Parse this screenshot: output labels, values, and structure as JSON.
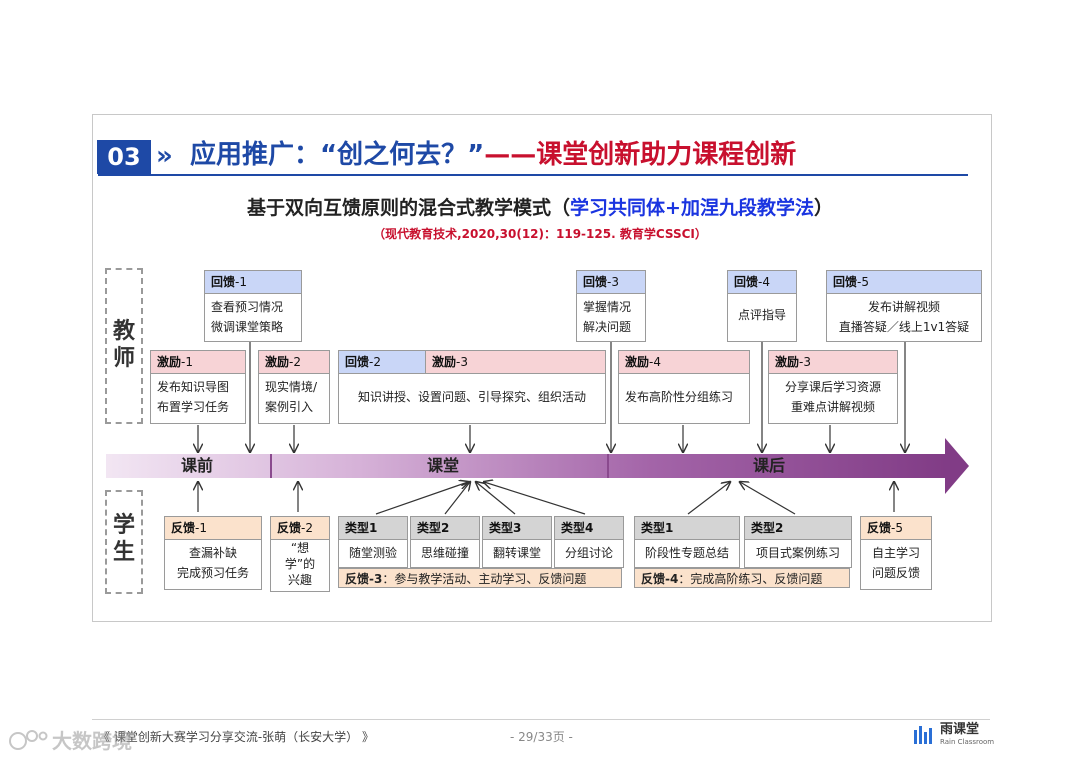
{
  "slide": {
    "section_number": "03",
    "chevron": "»",
    "heading_part1": "应用推广：“创之何去？”",
    "heading_part2": "——课堂创新助力课程创新",
    "subtitle_main": "基于双向互馈原则的混合式教学模式（",
    "subtitle_highlight": "学习共同体+加涅九段教学法",
    "subtitle_close": "）",
    "citation": "（现代教育技术,2020,30(12)：119-125. 教育学CSSCI）"
  },
  "roles": {
    "teacher": "教\n师",
    "student": "学\n生"
  },
  "phases": {
    "pre": "课前",
    "in": "课堂",
    "post": "课后"
  },
  "teacher_top": [
    {
      "tag": "回馈",
      "num": "-1",
      "text": "查看预习情况\n微调课堂策略"
    },
    {
      "tag": "回馈",
      "num": "-3",
      "text": "掌握情况\n解决问题"
    },
    {
      "tag": "回馈",
      "num": "-4",
      "text": "点评指导"
    },
    {
      "tag": "回馈",
      "num": "-5",
      "text": "发布讲解视频\n直播答疑／线上1v1答疑"
    }
  ],
  "teacher_mid": [
    {
      "tag": "激励",
      "num": "-1",
      "text": "发布知识导图\n布置学习任务"
    },
    {
      "tag": "激励",
      "num": "-2",
      "text": "现实情境/\n案例引入"
    },
    {
      "tag": "回馈",
      "num": "-2"
    },
    {
      "tag": "激励",
      "num": "-3",
      "text": "知识讲授、设置问题、引导探究、组织活动"
    },
    {
      "tag": "激励",
      "num": "-4",
      "text": "发布高阶性分组练习"
    },
    {
      "tag": "激励",
      "num": "-3",
      "text": "分享课后学习资源\n重难点讲解视频"
    }
  ],
  "student": {
    "fb1": {
      "tag": "反馈",
      "num": "-1",
      "text": "查漏补缺\n完成预习任务"
    },
    "fb2": {
      "tag": "反馈",
      "num": "-2",
      "text": "“想\n学”的\n兴趣"
    },
    "class_types": [
      {
        "tag": "类型1",
        "text": "随堂测验"
      },
      {
        "tag": "类型2",
        "text": "思维碰撞"
      },
      {
        "tag": "类型3",
        "text": "翻转课堂"
      },
      {
        "tag": "类型4",
        "text": "分组讨论"
      }
    ],
    "fb3": {
      "tag": "反馈",
      "num": "-3",
      "text": "：参与教学活动、主动学习、反馈问题"
    },
    "post_types": [
      {
        "tag": "类型1",
        "text": "阶段性专题总结"
      },
      {
        "tag": "类型2",
        "text": "项目式案例练习"
      }
    ],
    "fb4": {
      "tag": "反馈",
      "num": "-4",
      "text": "：完成高阶练习、反馈问题"
    },
    "fb5": {
      "tag": "反馈",
      "num": "-5",
      "text": "自主学习\n问题反馈"
    }
  },
  "footer": {
    "left": "《 课堂创新大赛学习分享交流-张萌（长安大学） 》",
    "page": "- 29/33页 -",
    "logo_cn": "雨课堂",
    "logo_en": "Rain Classroom",
    "watermark": "大数跨境"
  },
  "colors": {
    "brand_blue": "#1e49a6",
    "accent_red": "#c8102e",
    "arrow_purple": "#813c86"
  }
}
